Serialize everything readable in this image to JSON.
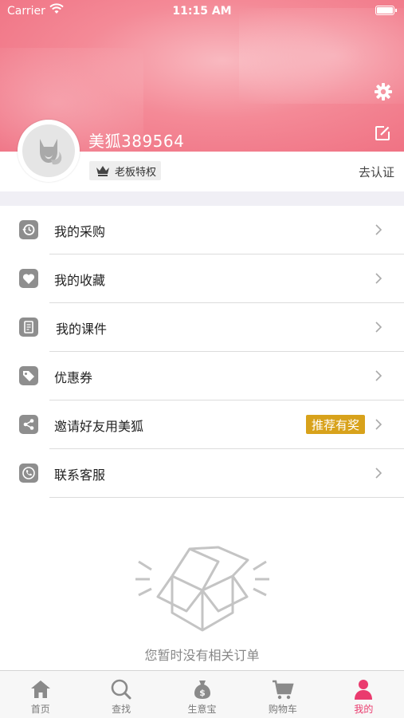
{
  "status_bar": {
    "carrier": "Carrier",
    "time": "11:15 AM"
  },
  "profile": {
    "username": "美狐389564",
    "badge_label": "老板特权",
    "certify_label": "去认证"
  },
  "menu": [
    {
      "label": "我的采购",
      "icon": "purchase-history-icon"
    },
    {
      "label": "我的收藏",
      "icon": "heart-icon"
    },
    {
      "label": "我的课件",
      "icon": "document-icon"
    },
    {
      "label": "优惠券",
      "icon": "coupon-tag-icon"
    },
    {
      "label": "邀请好友用美狐",
      "icon": "share-icon",
      "badge": "推荐有奖"
    },
    {
      "label": "联系客服",
      "icon": "phone-icon"
    }
  ],
  "empty_state": {
    "text": "您暂时没有相关订单"
  },
  "tabbar": [
    {
      "label": "首页",
      "icon": "home-icon"
    },
    {
      "label": "查找",
      "icon": "search-icon"
    },
    {
      "label": "生意宝",
      "icon": "money-bag-icon"
    },
    {
      "label": "购物车",
      "icon": "cart-icon"
    },
    {
      "label": "我的",
      "icon": "person-icon",
      "active": true
    }
  ],
  "colors": {
    "header_pink": "#f48a97",
    "active_tab": "#ea3b6e",
    "promo_badge": "#d8a21b",
    "menu_icon": "#8e8e8e",
    "gap_bar": "#f0eff5"
  }
}
